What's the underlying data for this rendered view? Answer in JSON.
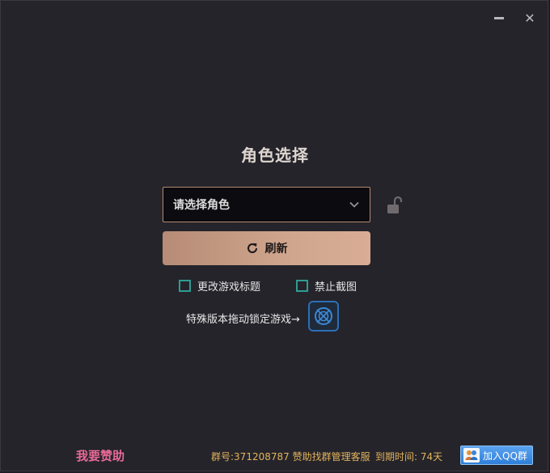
{
  "window": {
    "minimize_icon": "minimize-icon",
    "close_icon": "close-icon",
    "close_glyph": "✕"
  },
  "main": {
    "title": "角色选择",
    "role_select": {
      "value": "请选择角色",
      "icon": "chevron-down-icon"
    },
    "lock_icon": "unlocked-padlock-icon",
    "refresh": {
      "label": "刷新",
      "icon": "refresh-icon"
    },
    "options": [
      {
        "label": "更改游戏标题",
        "checked": false
      },
      {
        "label": "禁止截图",
        "checked": false
      }
    ],
    "special": {
      "label": "特殊版本拖动锁定游戏→",
      "target_icon": "crosshair-target-icon"
    }
  },
  "footer": {
    "sponsor": "我要赞助",
    "group_info": "群号:371208787 赞助找群管理客服",
    "expire": "到期时间: 74天",
    "qq_button": "加入QQ群",
    "qq_icon": "qq-group-icon"
  },
  "colors": {
    "background": "#25242b",
    "accent_border": "#b28b6e",
    "button_gradient_start": "#b78b76",
    "button_gradient_end": "#d9ad95",
    "checkbox": "#2f9c94",
    "sponsor": "#e96a97",
    "footer_text": "#e2b35b",
    "qq_button": "#2f7fd9"
  }
}
